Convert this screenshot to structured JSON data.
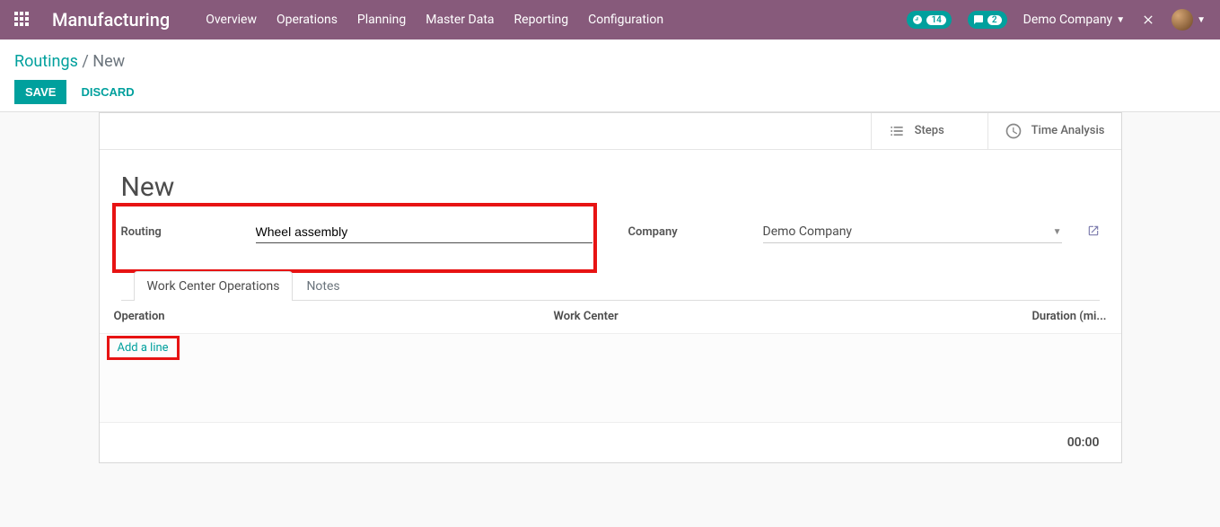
{
  "nav": {
    "brand": "Manufacturing",
    "menu": [
      "Overview",
      "Operations",
      "Planning",
      "Master Data",
      "Reporting",
      "Configuration"
    ],
    "activity_count": "14",
    "message_count": "2",
    "company": "Demo Company"
  },
  "breadcrumb": {
    "root": "Routings",
    "sep": " / ",
    "current": "New"
  },
  "buttons": {
    "save": "SAVE",
    "discard": "DISCARD"
  },
  "statbuttons": {
    "steps": "Steps",
    "time_analysis": "Time Analysis"
  },
  "form": {
    "title": "New",
    "routing_label": "Routing",
    "routing_value": "Wheel assembly",
    "company_label": "Company",
    "company_value": "Demo Company"
  },
  "tabs": {
    "wco": "Work Center Operations",
    "notes": "Notes"
  },
  "grid": {
    "headers": {
      "operation": "Operation",
      "work_center": "Work Center",
      "duration": "Duration (mi..."
    },
    "add_line": "Add a line",
    "total": "00:00"
  }
}
